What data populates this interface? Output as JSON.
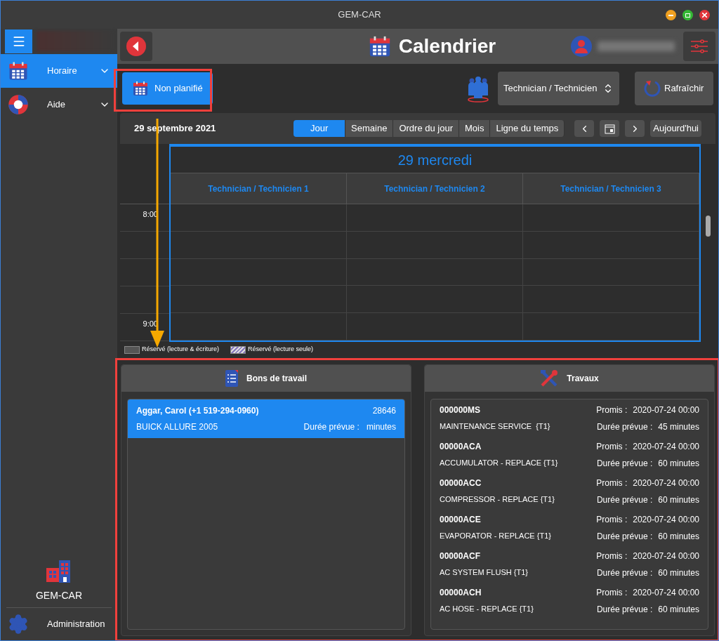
{
  "window": {
    "title": "GEM-CAR"
  },
  "sidebar": {
    "items": [
      {
        "label": "Horaire",
        "kind": "calendar",
        "selected": true
      },
      {
        "label": "Aide",
        "kind": "help",
        "selected": false
      }
    ],
    "brand": "GEM-CAR",
    "footer_item": "Administration"
  },
  "header": {
    "title": "Calendrier"
  },
  "toolbar": {
    "unplanned_button": "Non planifié",
    "resource_select": "Technician / Technicien",
    "refresh_button": "Rafraîchir"
  },
  "calendar": {
    "date": "29 septembre 2021",
    "views": [
      {
        "label": "Jour",
        "selected": true
      },
      {
        "label": "Semaine",
        "selected": false
      },
      {
        "label": "Ordre du jour",
        "selected": false
      },
      {
        "label": "Mois",
        "selected": false
      },
      {
        "label": "Ligne du temps",
        "selected": false
      }
    ],
    "today_button": "Aujourd'hui",
    "day_heading": "29 mercredi",
    "columns": [
      "Technician / Technicien 1",
      "Technician / Technicien 2",
      "Technician / Technicien 3"
    ],
    "time_labels": [
      "8:00",
      "9:00"
    ],
    "legend": [
      {
        "label": "Réservé (lecture & écriture)",
        "kind": "solid"
      },
      {
        "label": "Réservé (lecture seule)",
        "kind": "hatched"
      }
    ]
  },
  "work_orders": {
    "title": "Bons de travail",
    "items": [
      {
        "customer": "Aggar, Carol (+1 519-294-0960)",
        "number": "28646",
        "vehicle": "BUICK ALLURE 2005",
        "duration_label": "Durée prévue :",
        "duration": "minutes",
        "selected": true
      }
    ]
  },
  "jobs": {
    "title": "Travaux",
    "items": [
      {
        "code": "000000MS",
        "promised_label": "Promis :",
        "promised": "2020-07-24 00:00",
        "description": "MAINTENANCE SERVICE  {T1}",
        "duration_label": "Durée prévue :",
        "duration": "45 minutes"
      },
      {
        "code": "00000ACA",
        "promised_label": "Promis :",
        "promised": "2020-07-24 00:00",
        "description": "ACCUMULATOR - REPLACE {T1}",
        "duration_label": "Durée prévue :",
        "duration": "60 minutes"
      },
      {
        "code": "00000ACC",
        "promised_label": "Promis :",
        "promised": "2020-07-24 00:00",
        "description": "COMPRESSOR - REPLACE {T1}",
        "duration_label": "Durée prévue :",
        "duration": "60 minutes"
      },
      {
        "code": "00000ACE",
        "promised_label": "Promis :",
        "promised": "2020-07-24 00:00",
        "description": "EVAPORATOR - REPLACE {T1}",
        "duration_label": "Durée prévue :",
        "duration": "60 minutes"
      },
      {
        "code": "00000ACF",
        "promised_label": "Promis :",
        "promised": "2020-07-24 00:00",
        "description": "AC SYSTEM FLUSH {T1}",
        "duration_label": "Durée prévue :",
        "duration": "60 minutes"
      },
      {
        "code": "00000ACH",
        "promised_label": "Promis :",
        "promised": "2020-07-24 00:00",
        "description": "AC HOSE - REPLACE {T1}",
        "duration_label": "Durée prévue :",
        "duration": "60 minutes"
      }
    ]
  }
}
